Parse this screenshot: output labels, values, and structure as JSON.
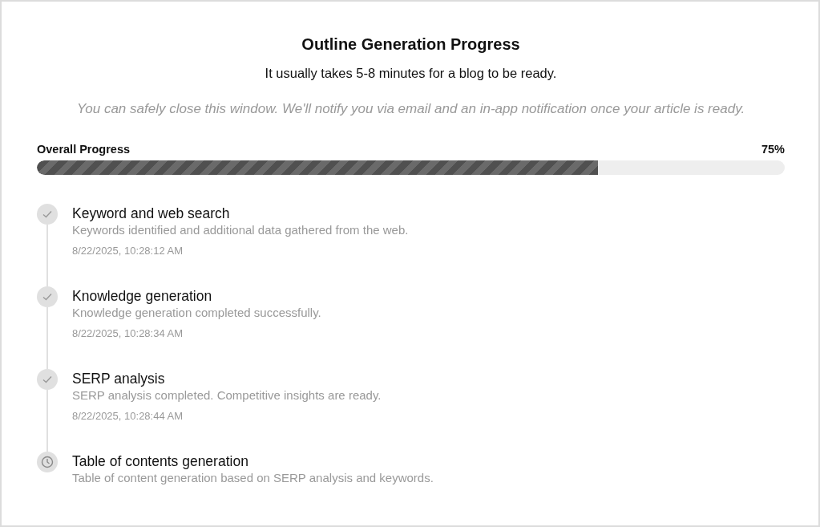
{
  "title": "Outline Generation Progress",
  "subtitle": "It usually takes 5-8 minutes for a blog to be ready.",
  "notice": "You can safely close this window. We'll notify you via email and an in-app notification once your article is ready.",
  "progress": {
    "label": "Overall Progress",
    "reading": "75%",
    "level": 0.75
  },
  "steps": [
    {
      "kind": "done",
      "title": "Keyword and web search",
      "description": "Keywords identified and additional data gathered from the web.",
      "time": "8/22/2025, 10:28:12 AM"
    },
    {
      "kind": "done",
      "title": "Knowledge generation",
      "description": "Knowledge generation completed successfully.",
      "time": "8/22/2025, 10:28:34 AM"
    },
    {
      "kind": "done",
      "title": "SERP analysis",
      "description": "SERP analysis completed. Competitive insights are ready.",
      "time": "8/22/2025, 10:28:44 AM"
    },
    {
      "kind": "pending",
      "title": "Table of contents generation",
      "description": "Table of content generation based on SERP analysis and keywords."
    }
  ]
}
